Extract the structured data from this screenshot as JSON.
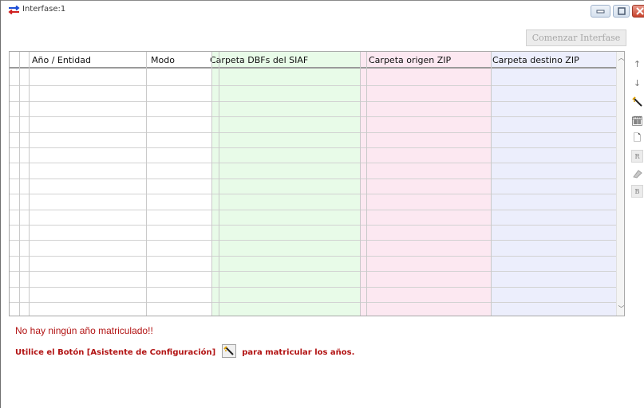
{
  "window": {
    "title": "Interfase:1"
  },
  "toolbar": {
    "comenzar_label": "Comenzar Interfase"
  },
  "grid": {
    "columns": [
      "Año / Entidad",
      "Modo",
      "Carpeta DBFs del SIAF",
      "Carpeta origen ZIP",
      "Carpeta destino ZIP"
    ],
    "row_count": 16,
    "column_colors": {
      "carpeta_dbfs": "#e8fbe8",
      "carpeta_origen": "#fce8f1",
      "carpeta_destino": "#eceefc"
    }
  },
  "side_toolbar": {
    "items": [
      {
        "icon": "arrow-up-icon",
        "glyph": "↑"
      },
      {
        "icon": "arrow-down-icon",
        "glyph": "↓"
      },
      {
        "icon": "wizard-wand-icon",
        "glyph": ""
      },
      {
        "icon": "calendar-icon",
        "glyph": "🗓"
      },
      {
        "icon": "new-document-icon",
        "glyph": "🗋"
      },
      {
        "icon": "r-button-icon",
        "glyph": "R"
      },
      {
        "icon": "eraser-icon",
        "glyph": ""
      },
      {
        "icon": "b-button-icon",
        "glyph": "B"
      }
    ]
  },
  "messages": {
    "no_years": "No hay ningún año matriculado!!",
    "hint_prefix": "Utilice el Botón [Asistente de Configuración]",
    "hint_suffix": "para matricular los años."
  }
}
